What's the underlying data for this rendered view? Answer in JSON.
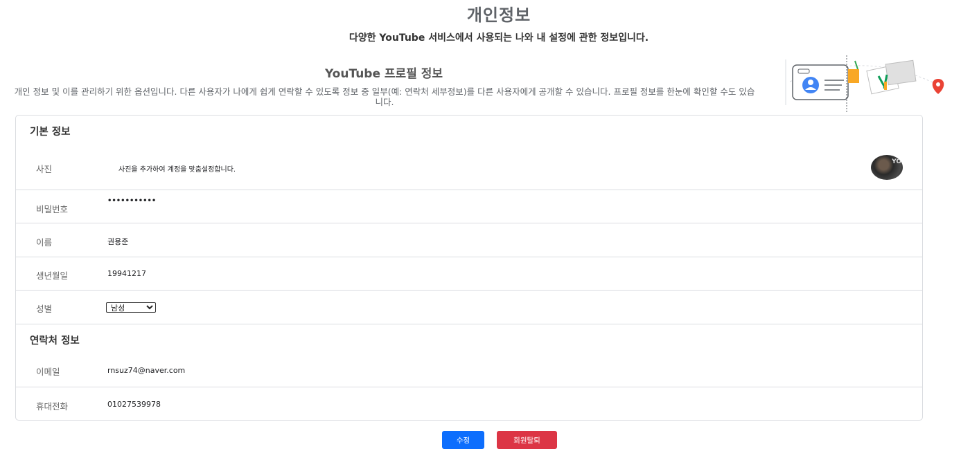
{
  "header": {
    "title": "개인정보",
    "subtitle": "다양한 YouTube 서비스에서 사용되는 나와 내 설정에 관한 정보입니다."
  },
  "profile_section": {
    "heading": "YouTube 프로필 정보",
    "description": "개인 정보 및 이를 관리하기 위한 옵션입니다. 다른 사용자가 나에게 쉽게 연락할 수 있도록 정보 중 일부(예: 연락처 세부정보)를 다른 사용자에게 공개할 수 있습니다. 프로필 정보를 한눈에 확인할 수도 있습니다."
  },
  "basic_info": {
    "title": "기본 정보",
    "photo_label": "사진",
    "photo_hint": "사진을 추가하여 계정을 맞춤설정합니다.",
    "avatar_text": "YO",
    "password_label": "비밀번호",
    "password_value": "•••••••••••",
    "name_label": "이름",
    "name_value": "권용준",
    "birth_label": "생년월일",
    "birth_value": "19941217",
    "gender_label": "성별",
    "gender_value": "남성"
  },
  "contact_info": {
    "title": "연락처 정보",
    "email_label": "이메일",
    "email_value": "rnsuz74@naver.com",
    "phone_label": "휴대전화",
    "phone_value": "01027539978"
  },
  "actions": {
    "edit_label": "수정",
    "withdraw_label": "회원탈퇴"
  },
  "colors": {
    "edit_button": "#0d6efd",
    "withdraw_button": "#dc3545",
    "border": "#dadce0"
  }
}
